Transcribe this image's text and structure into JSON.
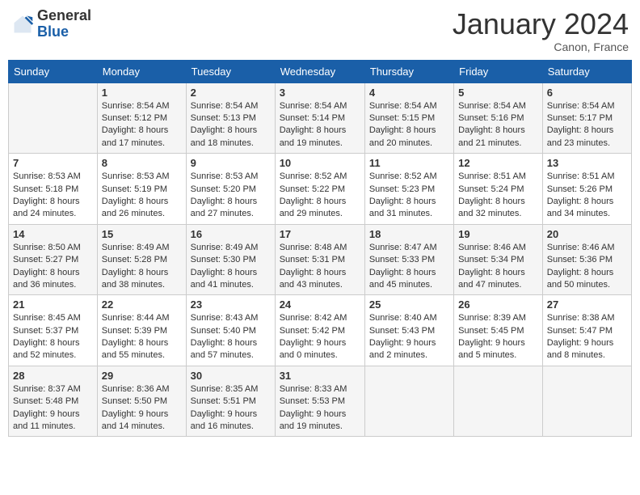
{
  "logo": {
    "general": "General",
    "blue": "Blue"
  },
  "header": {
    "month_year": "January 2024",
    "location": "Canon, France"
  },
  "days_of_week": [
    "Sunday",
    "Monday",
    "Tuesday",
    "Wednesday",
    "Thursday",
    "Friday",
    "Saturday"
  ],
  "weeks": [
    [
      {
        "day": "",
        "content": ""
      },
      {
        "day": "1",
        "content": "Sunrise: 8:54 AM\nSunset: 5:12 PM\nDaylight: 8 hours\nand 17 minutes."
      },
      {
        "day": "2",
        "content": "Sunrise: 8:54 AM\nSunset: 5:13 PM\nDaylight: 8 hours\nand 18 minutes."
      },
      {
        "day": "3",
        "content": "Sunrise: 8:54 AM\nSunset: 5:14 PM\nDaylight: 8 hours\nand 19 minutes."
      },
      {
        "day": "4",
        "content": "Sunrise: 8:54 AM\nSunset: 5:15 PM\nDaylight: 8 hours\nand 20 minutes."
      },
      {
        "day": "5",
        "content": "Sunrise: 8:54 AM\nSunset: 5:16 PM\nDaylight: 8 hours\nand 21 minutes."
      },
      {
        "day": "6",
        "content": "Sunrise: 8:54 AM\nSunset: 5:17 PM\nDaylight: 8 hours\nand 23 minutes."
      }
    ],
    [
      {
        "day": "7",
        "content": "Sunrise: 8:53 AM\nSunset: 5:18 PM\nDaylight: 8 hours\nand 24 minutes."
      },
      {
        "day": "8",
        "content": "Sunrise: 8:53 AM\nSunset: 5:19 PM\nDaylight: 8 hours\nand 26 minutes."
      },
      {
        "day": "9",
        "content": "Sunrise: 8:53 AM\nSunset: 5:20 PM\nDaylight: 8 hours\nand 27 minutes."
      },
      {
        "day": "10",
        "content": "Sunrise: 8:52 AM\nSunset: 5:22 PM\nDaylight: 8 hours\nand 29 minutes."
      },
      {
        "day": "11",
        "content": "Sunrise: 8:52 AM\nSunset: 5:23 PM\nDaylight: 8 hours\nand 31 minutes."
      },
      {
        "day": "12",
        "content": "Sunrise: 8:51 AM\nSunset: 5:24 PM\nDaylight: 8 hours\nand 32 minutes."
      },
      {
        "day": "13",
        "content": "Sunrise: 8:51 AM\nSunset: 5:26 PM\nDaylight: 8 hours\nand 34 minutes."
      }
    ],
    [
      {
        "day": "14",
        "content": "Sunrise: 8:50 AM\nSunset: 5:27 PM\nDaylight: 8 hours\nand 36 minutes."
      },
      {
        "day": "15",
        "content": "Sunrise: 8:49 AM\nSunset: 5:28 PM\nDaylight: 8 hours\nand 38 minutes."
      },
      {
        "day": "16",
        "content": "Sunrise: 8:49 AM\nSunset: 5:30 PM\nDaylight: 8 hours\nand 41 minutes."
      },
      {
        "day": "17",
        "content": "Sunrise: 8:48 AM\nSunset: 5:31 PM\nDaylight: 8 hours\nand 43 minutes."
      },
      {
        "day": "18",
        "content": "Sunrise: 8:47 AM\nSunset: 5:33 PM\nDaylight: 8 hours\nand 45 minutes."
      },
      {
        "day": "19",
        "content": "Sunrise: 8:46 AM\nSunset: 5:34 PM\nDaylight: 8 hours\nand 47 minutes."
      },
      {
        "day": "20",
        "content": "Sunrise: 8:46 AM\nSunset: 5:36 PM\nDaylight: 8 hours\nand 50 minutes."
      }
    ],
    [
      {
        "day": "21",
        "content": "Sunrise: 8:45 AM\nSunset: 5:37 PM\nDaylight: 8 hours\nand 52 minutes."
      },
      {
        "day": "22",
        "content": "Sunrise: 8:44 AM\nSunset: 5:39 PM\nDaylight: 8 hours\nand 55 minutes."
      },
      {
        "day": "23",
        "content": "Sunrise: 8:43 AM\nSunset: 5:40 PM\nDaylight: 8 hours\nand 57 minutes."
      },
      {
        "day": "24",
        "content": "Sunrise: 8:42 AM\nSunset: 5:42 PM\nDaylight: 9 hours\nand 0 minutes."
      },
      {
        "day": "25",
        "content": "Sunrise: 8:40 AM\nSunset: 5:43 PM\nDaylight: 9 hours\nand 2 minutes."
      },
      {
        "day": "26",
        "content": "Sunrise: 8:39 AM\nSunset: 5:45 PM\nDaylight: 9 hours\nand 5 minutes."
      },
      {
        "day": "27",
        "content": "Sunrise: 8:38 AM\nSunset: 5:47 PM\nDaylight: 9 hours\nand 8 minutes."
      }
    ],
    [
      {
        "day": "28",
        "content": "Sunrise: 8:37 AM\nSunset: 5:48 PM\nDaylight: 9 hours\nand 11 minutes."
      },
      {
        "day": "29",
        "content": "Sunrise: 8:36 AM\nSunset: 5:50 PM\nDaylight: 9 hours\nand 14 minutes."
      },
      {
        "day": "30",
        "content": "Sunrise: 8:35 AM\nSunset: 5:51 PM\nDaylight: 9 hours\nand 16 minutes."
      },
      {
        "day": "31",
        "content": "Sunrise: 8:33 AM\nSunset: 5:53 PM\nDaylight: 9 hours\nand 19 minutes."
      },
      {
        "day": "",
        "content": ""
      },
      {
        "day": "",
        "content": ""
      },
      {
        "day": "",
        "content": ""
      }
    ]
  ]
}
